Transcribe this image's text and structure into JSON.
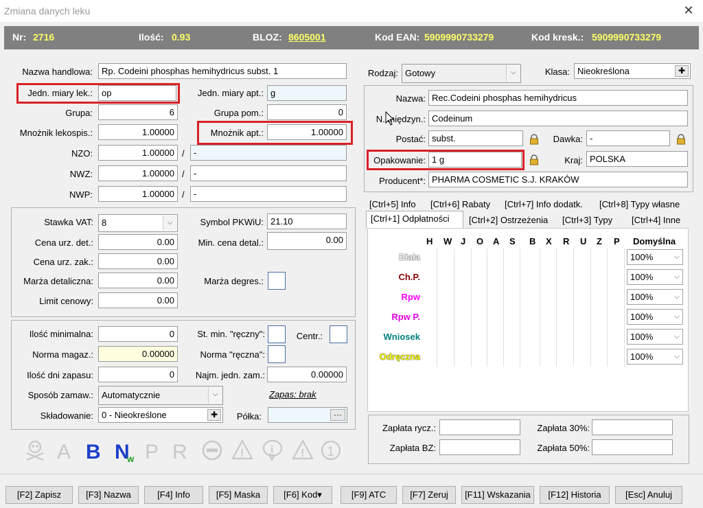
{
  "window": {
    "title": "Zmiana danych leku",
    "close_glyph": "✕"
  },
  "infobar": {
    "nr_label": "Nr:",
    "nr_value": "2716",
    "ilosc_label": "Ilość:",
    "ilosc_value": "0.93",
    "bloz_label": "BLOZ:",
    "bloz_value": "8605001",
    "ean_label": "Kod EAN:",
    "ean_value": "5909990733279",
    "kresk_label": "Kod kresk.:",
    "kresk_value": "5909990733279"
  },
  "left": {
    "nazwa_handlowa": {
      "label": "Nazwa handlowa:",
      "value": "Rp. Codeini phosphas hemihydricus subst. 1"
    },
    "jedn_miary_lek": {
      "label": "Jedn. miary lek.:",
      "value": "op"
    },
    "jedn_miary_apt": {
      "label": "Jedn. miary apt.:",
      "value": "g"
    },
    "grupa": {
      "label": "Grupa:",
      "value": "6"
    },
    "grupa_pom": {
      "label": "Grupa pom.:",
      "value": "0"
    },
    "mnoznik_lekospis": {
      "label": "Mnożnik lekospis.:",
      "value": "1.00000"
    },
    "mnoznik_apt": {
      "label": "Mnożnik apt.:",
      "value": "1.00000"
    },
    "nzo": {
      "label": "NZO:",
      "value": "1.00000",
      "extra": "-"
    },
    "nwz": {
      "label": "NWZ:",
      "value": "1.00000",
      "extra": "-"
    },
    "nwp": {
      "label": "NWP:",
      "value": "1.00000",
      "extra": "-"
    },
    "slash": "/"
  },
  "pricing": {
    "stawka_vat": {
      "label": "Stawka VAT:",
      "value": "8"
    },
    "symbol_pkwiu": {
      "label": "Symbol PKWiU:",
      "value": "21.10"
    },
    "cena_urz_det": {
      "label": "Cena urz. det.:",
      "value": "0.00"
    },
    "min_cena_detal": {
      "label": "Min. cena detal.:",
      "value": "0.00"
    },
    "cena_urz_zak": {
      "label": "Cena urz. zak.:",
      "value": "0.00"
    },
    "marza_detaliczna": {
      "label": "Marża detaliczna:",
      "value": "0.00"
    },
    "marza_degres": {
      "label": "Marża degres.:"
    },
    "limit_cenowy": {
      "label": "Limit cenowy:",
      "value": "0.00"
    }
  },
  "stock": {
    "ilosc_minimalna": {
      "label": "Ilość minimalna:",
      "value": "0"
    },
    "st_min_reczny": {
      "label": "St. min. \"ręczny\":"
    },
    "centr": {
      "label": "Centr.:"
    },
    "norma_magaz": {
      "label": "Norma magaz.:",
      "value": "0.00000"
    },
    "norma_reczna": {
      "label": "Norma \"ręczna\":"
    },
    "ilosc_dni_zapasu": {
      "label": "Ilość dni zapasu:",
      "value": "0"
    },
    "najm_jedn_zam": {
      "label": "Najm. jedn. zam.:",
      "value": "0.00000"
    },
    "sposob_zamaw": {
      "label": "Sposób zamaw.:",
      "value": "Automatycznie"
    },
    "zapas": "Zapas: brak",
    "skladowanie": {
      "label": "Składowanie:",
      "value": "0 - Nieokreślone"
    },
    "polka": {
      "label": "Półka:",
      "value": "",
      "btn": "···"
    },
    "plus_glyph": "✚"
  },
  "right": {
    "rodzaj": {
      "label": "Rodzaj:",
      "value": "Gotowy"
    },
    "klasa": {
      "label": "Klasa:",
      "value": "Nieokreślona"
    },
    "nazwa": {
      "label": "Nazwa:",
      "value": "Rec.Codeini phosphas hemihydricus"
    },
    "n_miedzyn": {
      "label": "N. międzyn.:",
      "value": "Codeinum"
    },
    "postac": {
      "label": "Postać:",
      "value": "subst."
    },
    "dawka": {
      "label": "Dawka:",
      "value": "-"
    },
    "opakowanie": {
      "label": "Opakowanie:",
      "value": "1 g"
    },
    "kraj": {
      "label": "Kraj:",
      "value": "POLSKA"
    },
    "producent": {
      "label": "Producent*:",
      "value": "PHARMA COSMETIC S.J. KRAKÓW"
    }
  },
  "tabs": {
    "row1": [
      "[Ctrl+5] Info",
      "[Ctrl+6] Rabaty",
      "[Ctrl+7] Info dodatk.",
      "[Ctrl+8] Typy własne"
    ],
    "row2": [
      "[Ctrl+1] Odpłatności",
      "[Ctrl+2] Ostrzeżenia",
      "[Ctrl+3] Typy",
      "[Ctrl+4] Inne"
    ]
  },
  "grid": {
    "columns": [
      "H",
      "W",
      "J",
      "O",
      "A",
      "S",
      "B",
      "X",
      "R",
      "U",
      "Z",
      "P"
    ],
    "default_header": "Domyślna",
    "rows": [
      {
        "label": "Biała",
        "color": "#ffffff",
        "default": "100%"
      },
      {
        "label": "Ch.P.",
        "color": "#8b0000",
        "default": "100%"
      },
      {
        "label": "Rpw",
        "color": "#ff00ff",
        "default": "100%"
      },
      {
        "label": "Rpw P.",
        "color": "#e600e6",
        "default": "100%"
      },
      {
        "label": "Wniosek",
        "color": "#008080",
        "default": "100%"
      },
      {
        "label": "Odręczna",
        "color": "#ffff00",
        "default": "100%"
      }
    ]
  },
  "payments": {
    "zaplata_rycz": {
      "label": "Zapłata rycz.:",
      "value": ""
    },
    "zaplata_30": {
      "label": "Zapłata 30%:",
      "value": ""
    },
    "zaplata_bz": {
      "label": "Zapłata BZ:",
      "value": ""
    },
    "zaplata_50": {
      "label": "Zapłata 50%:",
      "value": ""
    }
  },
  "status_icons": [
    "skull-icon",
    "a-letter-icon",
    "b-letter-icon",
    "n-letter-icon",
    "p-letter-icon",
    "r-letter-icon",
    "no-entry-icon",
    "warning-icon",
    "info-icon",
    "warning-outline-icon",
    "number-one-icon"
  ],
  "icon_letters": {
    "a": "A",
    "b": "B",
    "n": "N",
    "n_sub": "W",
    "p": "P",
    "r": "R",
    "one": "1",
    "i": "i",
    "excl": "!"
  },
  "footer": {
    "buttons": [
      "[F2] Zapisz",
      "[F3] Nazwa",
      "[F4] Info",
      "[F5] Maska",
      "[F6] Kod",
      "[F9] ATC",
      "[F7] Zeruj",
      "[F11] Wskazania",
      "[F12] Historia",
      "[Esc] Anuluj"
    ],
    "dropdown_glyph": "▾"
  },
  "colors": {
    "highlight": "#d92027",
    "infobar_bg": "#808080",
    "infobar_value": "#ffff66"
  }
}
